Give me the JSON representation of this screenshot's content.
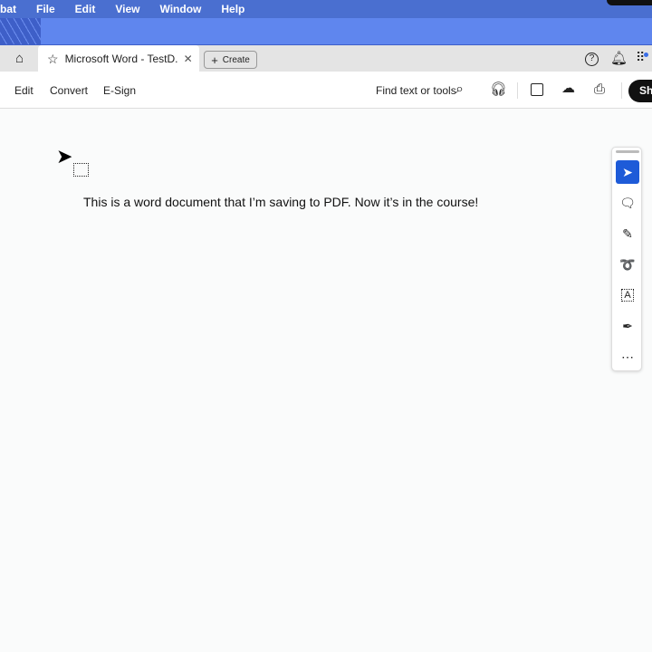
{
  "menubar": {
    "app": "bat",
    "items": [
      "File",
      "Edit",
      "View",
      "Window",
      "Help"
    ]
  },
  "tabs": {
    "active_title": "Microsoft Word - TestD...",
    "create_label": "Create"
  },
  "toolbar": {
    "items": [
      "Edit",
      "Convert",
      "E-Sign"
    ],
    "search_label": "Find text or tools",
    "share_label": "Sh"
  },
  "document": {
    "text": "This is a word document that I’m saving to PDF. Now it’s in the course!"
  },
  "accent": "#1e5bd8"
}
